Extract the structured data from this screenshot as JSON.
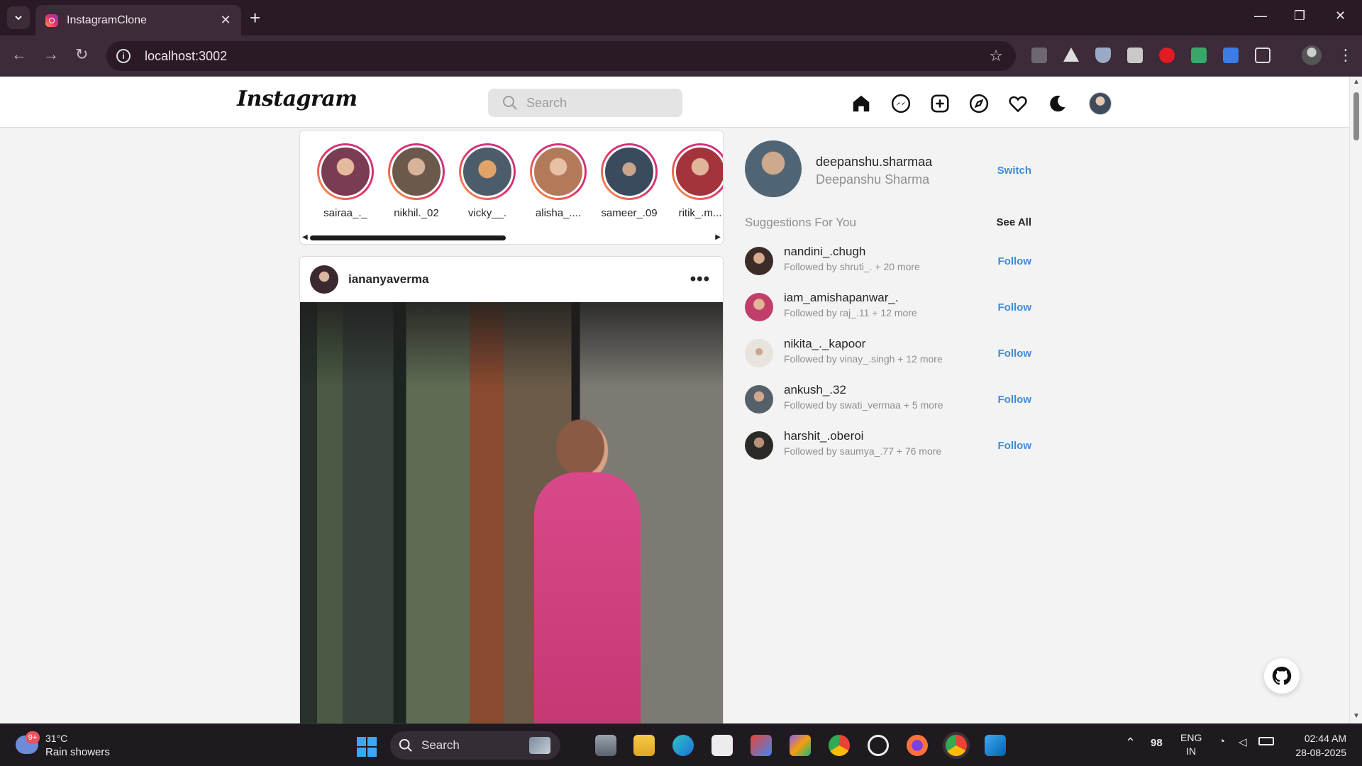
{
  "browser": {
    "tab_title": "InstagramClone",
    "url": "localhost:3002"
  },
  "header": {
    "logo": "Instagram",
    "search_placeholder": "Search"
  },
  "stories": [
    {
      "username": "sairaa_._"
    },
    {
      "username": "nikhil._02"
    },
    {
      "username": "vicky__."
    },
    {
      "username": "alisha_...."
    },
    {
      "username": "sameer_.09"
    },
    {
      "username": "ritik_.m..."
    }
  ],
  "post": {
    "username": "iananyaverma",
    "more": "•••"
  },
  "sidebar": {
    "username": "deepanshu.sharmaa",
    "full_name": "Deepanshu Sharma",
    "switch_label": "Switch",
    "suggestions_title": "Suggestions For You",
    "see_all_label": "See All",
    "suggestions": [
      {
        "username": "nandini_.chugh",
        "followed_by": "Followed by shruti_. + 20 more",
        "action": "Follow"
      },
      {
        "username": "iam_amishapanwar_.",
        "followed_by": "Followed by raj_.11 + 12 more",
        "action": "Follow"
      },
      {
        "username": "nikita_._kapoor",
        "followed_by": "Followed by vinay_.singh + 12 more",
        "action": "Follow"
      },
      {
        "username": "ankush_.32",
        "followed_by": "Followed by swati_vermaa + 5 more",
        "action": "Follow"
      },
      {
        "username": "harshit_.oberoi",
        "followed_by": "Followed by saumya_.77 + 76 more",
        "action": "Follow"
      }
    ]
  },
  "taskbar": {
    "weather_badge": "9+",
    "temperature": "31°C",
    "weather": "Rain showers",
    "search_label": "Search",
    "tray_number": "98",
    "lang_top": "ENG",
    "lang_bottom": "IN",
    "time": "02:44 AM",
    "date": "28-08-2025"
  },
  "colors": {
    "link_blue": "#3f8bd8",
    "story_ring": "#e1306c",
    "browser_frame": "#2a1a26"
  }
}
